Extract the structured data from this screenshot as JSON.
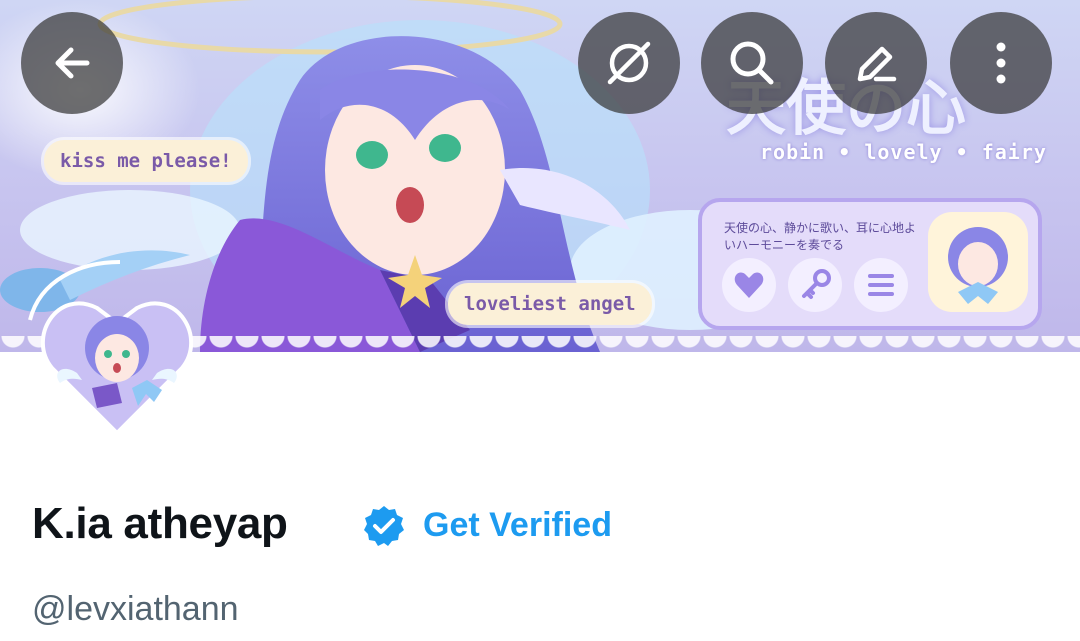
{
  "header": {
    "banner_pill_1": "kiss me please!",
    "banner_pill_2": "loveliest angel",
    "banner_title_jp": "天使の心",
    "banner_subtitle": "robin • lovely • fairy",
    "banner_card_text": "天使の心、静かに歌い、耳に心地よいハーモニーを奏でる"
  },
  "toolbar": {
    "back": "back-arrow-icon",
    "no_animation": "no-animation-icon",
    "search": "search-icon",
    "edit": "edit-icon",
    "more": "more-vertical-icon"
  },
  "profile": {
    "display_name": "K.ia atheyap",
    "verified": true,
    "get_verified_label": "Get Verified",
    "handle": "@levxiathann"
  },
  "colors": {
    "accent": "#1d9bf0",
    "name": "#0f1419",
    "handle": "#536471",
    "button_bg": "#373737"
  }
}
